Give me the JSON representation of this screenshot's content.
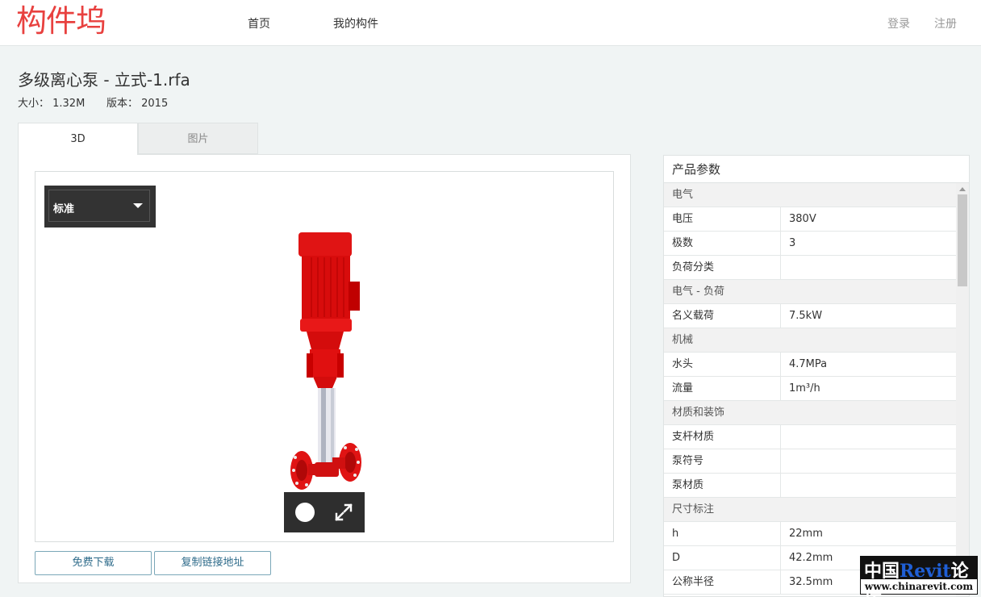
{
  "header": {
    "logo": "构件坞",
    "nav": {
      "home": "首页",
      "mine": "我的构件"
    },
    "auth": {
      "login": "登录",
      "register": "注册"
    }
  },
  "file": {
    "title": "多级离心泵 - 立式-1.rfa",
    "size": "大小： 1.32M",
    "version": "版本： 2015"
  },
  "tabs": {
    "tab_3d": "3D",
    "tab_images": "图片"
  },
  "viewer": {
    "view_select": "标准",
    "toolbar": {
      "orbit": "orbit-icon",
      "fullscreen": "expand-icon"
    }
  },
  "actions": {
    "download": "免费下载",
    "copy_link": "复制链接地址"
  },
  "params": {
    "title": "产品参数",
    "rows": [
      {
        "type": "group",
        "label": "电气"
      },
      {
        "type": "item",
        "key": "电压",
        "value": "380V"
      },
      {
        "type": "item",
        "key": "极数",
        "value": "3"
      },
      {
        "type": "item",
        "key": "负荷分类",
        "value": ""
      },
      {
        "type": "group",
        "label": "电气 - 负荷"
      },
      {
        "type": "item",
        "key": "名义载荷",
        "value": "7.5kW"
      },
      {
        "type": "group",
        "label": "机械"
      },
      {
        "type": "item",
        "key": "水头",
        "value": "4.7MPa"
      },
      {
        "type": "item",
        "key": "流量",
        "value": "1m³/h"
      },
      {
        "type": "group",
        "label": "材质和装饰"
      },
      {
        "type": "item",
        "key": "支杆材质",
        "value": ""
      },
      {
        "type": "item",
        "key": "泵符号",
        "value": ""
      },
      {
        "type": "item",
        "key": "泵材质",
        "value": ""
      },
      {
        "type": "group",
        "label": "尺寸标注"
      },
      {
        "type": "item",
        "key": "h",
        "value": "22mm"
      },
      {
        "type": "item",
        "key": "D",
        "value": "42.2mm"
      },
      {
        "type": "item",
        "key": "公称半径",
        "value": "32.5mm"
      }
    ]
  },
  "watermark": {
    "brand_cn_1": "中国",
    "brand_revit": "Revit",
    "brand_cn_2": "论坛",
    "url": "www.chinarevit.com"
  },
  "colors": {
    "logo": "#e8413f",
    "pump_red": "#e01010",
    "button_text": "#2e6b8a"
  }
}
